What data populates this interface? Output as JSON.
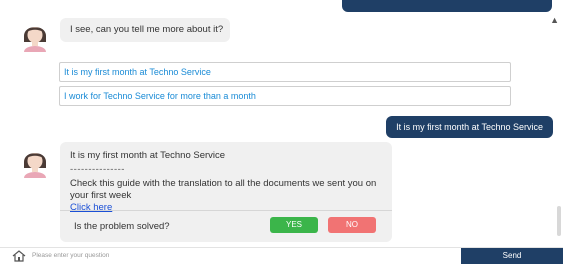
{
  "colors": {
    "accent": "#1f3f66",
    "link": "#1a8bd6",
    "yes": "#3bb54a",
    "no": "#f17373",
    "bubble": "#f0f0f0"
  },
  "messages": {
    "bot_question": "I see, can you tell me more about it?",
    "options": [
      "It is my first month at Techno Service",
      "I work for Techno Service for more than a month"
    ],
    "user_reply": "It is my first month at Techno Service",
    "bot_answer": {
      "title": "It is my first month at Techno Service",
      "divider": "---------------",
      "body": "Check this guide with the translation to all the documents we sent you on your first week",
      "link": "Click here",
      "solved_question": "Is the problem solved?",
      "yes_label": "YES",
      "no_label": "NO"
    }
  },
  "footer": {
    "placeholder": "Please enter your question",
    "send_label": "Send"
  }
}
